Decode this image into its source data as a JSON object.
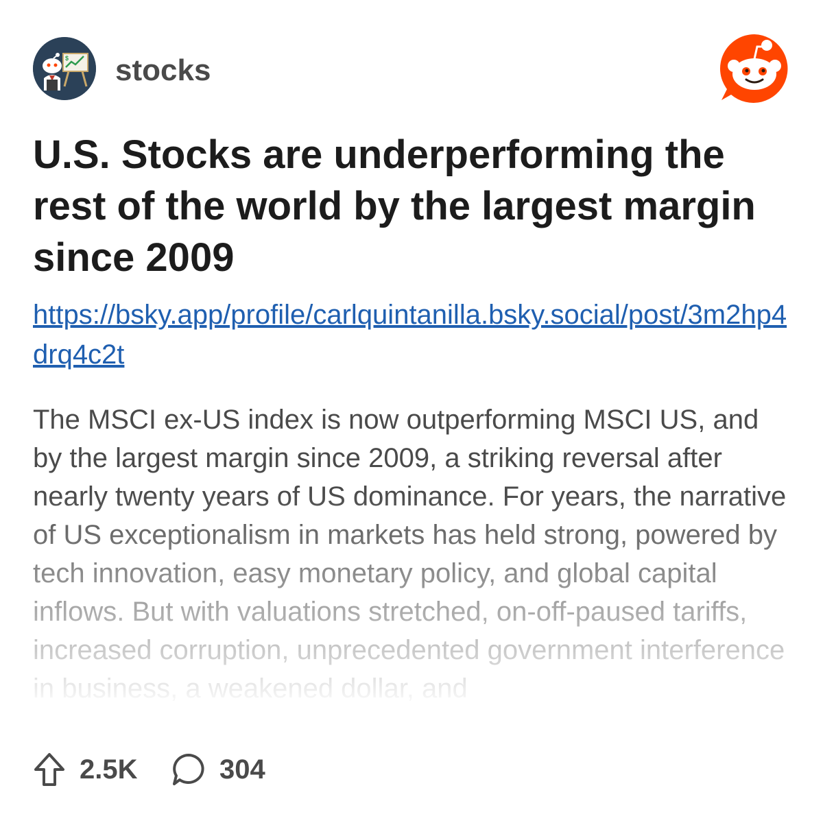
{
  "header": {
    "subreddit": "stocks",
    "avatar_icon": "stocks-subreddit-avatar-icon",
    "logo_icon": "reddit-logo-icon",
    "brand_color": "#ff4500"
  },
  "post": {
    "title": "U.S. Stocks are underperforming the rest of the world by the largest margin since 2009",
    "link": "https://bsky.app/profile/carlquintanilla.bsky.social/post/3m2hp4drq4c2t",
    "body": "The MSCI ex-US index is now outperforming MSCI US, and by the largest margin since 2009, a striking reversal after nearly twenty years of US dominance. For years, the narrative of US exceptionalism in markets has held strong, powered by tech innovation, easy monetary policy, and global capital inflows. But with valuations stretched, on-off-paused tariffs, increased corruption, unprecedented government interference in business, a weakened dollar, and"
  },
  "footer": {
    "upvotes": "2.5K",
    "upvote_icon": "upvote-arrow-icon",
    "comments": "304",
    "comment_icon": "comment-bubble-icon"
  }
}
